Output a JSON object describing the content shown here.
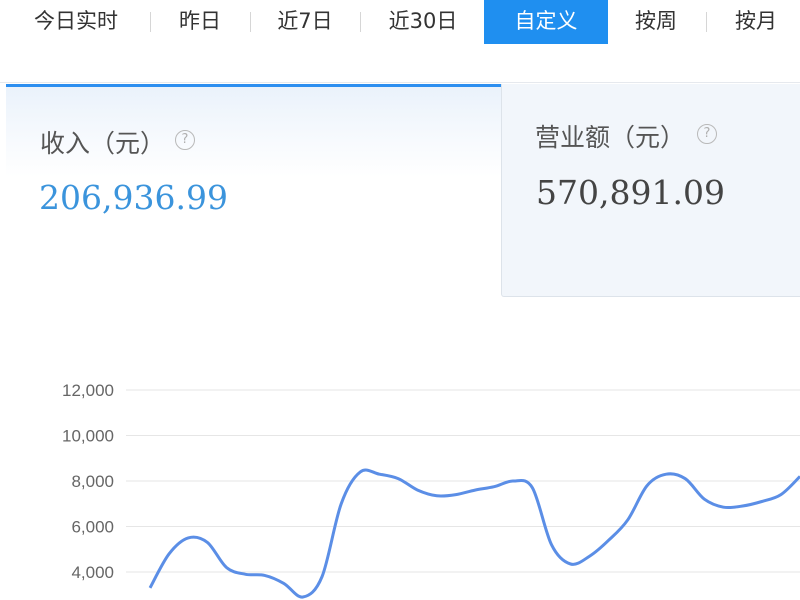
{
  "tabs": [
    {
      "label": "今日实时",
      "active": false
    },
    {
      "label": "昨日",
      "active": false
    },
    {
      "label": "近7日",
      "active": false
    },
    {
      "label": "近30日",
      "active": false
    },
    {
      "label": "自定义",
      "active": true
    },
    {
      "label": "按周",
      "active": false
    },
    {
      "label": "按月",
      "active": false
    }
  ],
  "metrics": [
    {
      "label": "收入（元）",
      "value": "206,936.99",
      "selected": true,
      "help_icon": "question-circle-icon"
    },
    {
      "label": "营业额（元）",
      "value": "570,891.09",
      "selected": false,
      "help_icon": "question-circle-icon"
    }
  ],
  "colors": {
    "accent": "#1f8ff0",
    "selected_value": "#3b94dc",
    "line": "#5b8ee6",
    "grid": "#e6e6e6"
  },
  "chart_data": {
    "type": "line",
    "yticks": [
      "12,000",
      "10,000",
      "8,000",
      "6,000",
      "4,000"
    ],
    "ylim": [
      4000,
      12000
    ],
    "grid": true,
    "series": [
      {
        "values": [
          3300,
          4800,
          5500,
          5300,
          4200,
          3900,
          3850,
          3500,
          2900,
          3800,
          7000,
          8400,
          8300,
          8100,
          7600,
          7350,
          7400,
          7600,
          7750,
          8000,
          7700,
          5200,
          4350,
          4700,
          5400,
          6300,
          7800,
          8300,
          8100,
          7200,
          6850,
          6900,
          7100,
          7400,
          8200
        ]
      }
    ]
  }
}
